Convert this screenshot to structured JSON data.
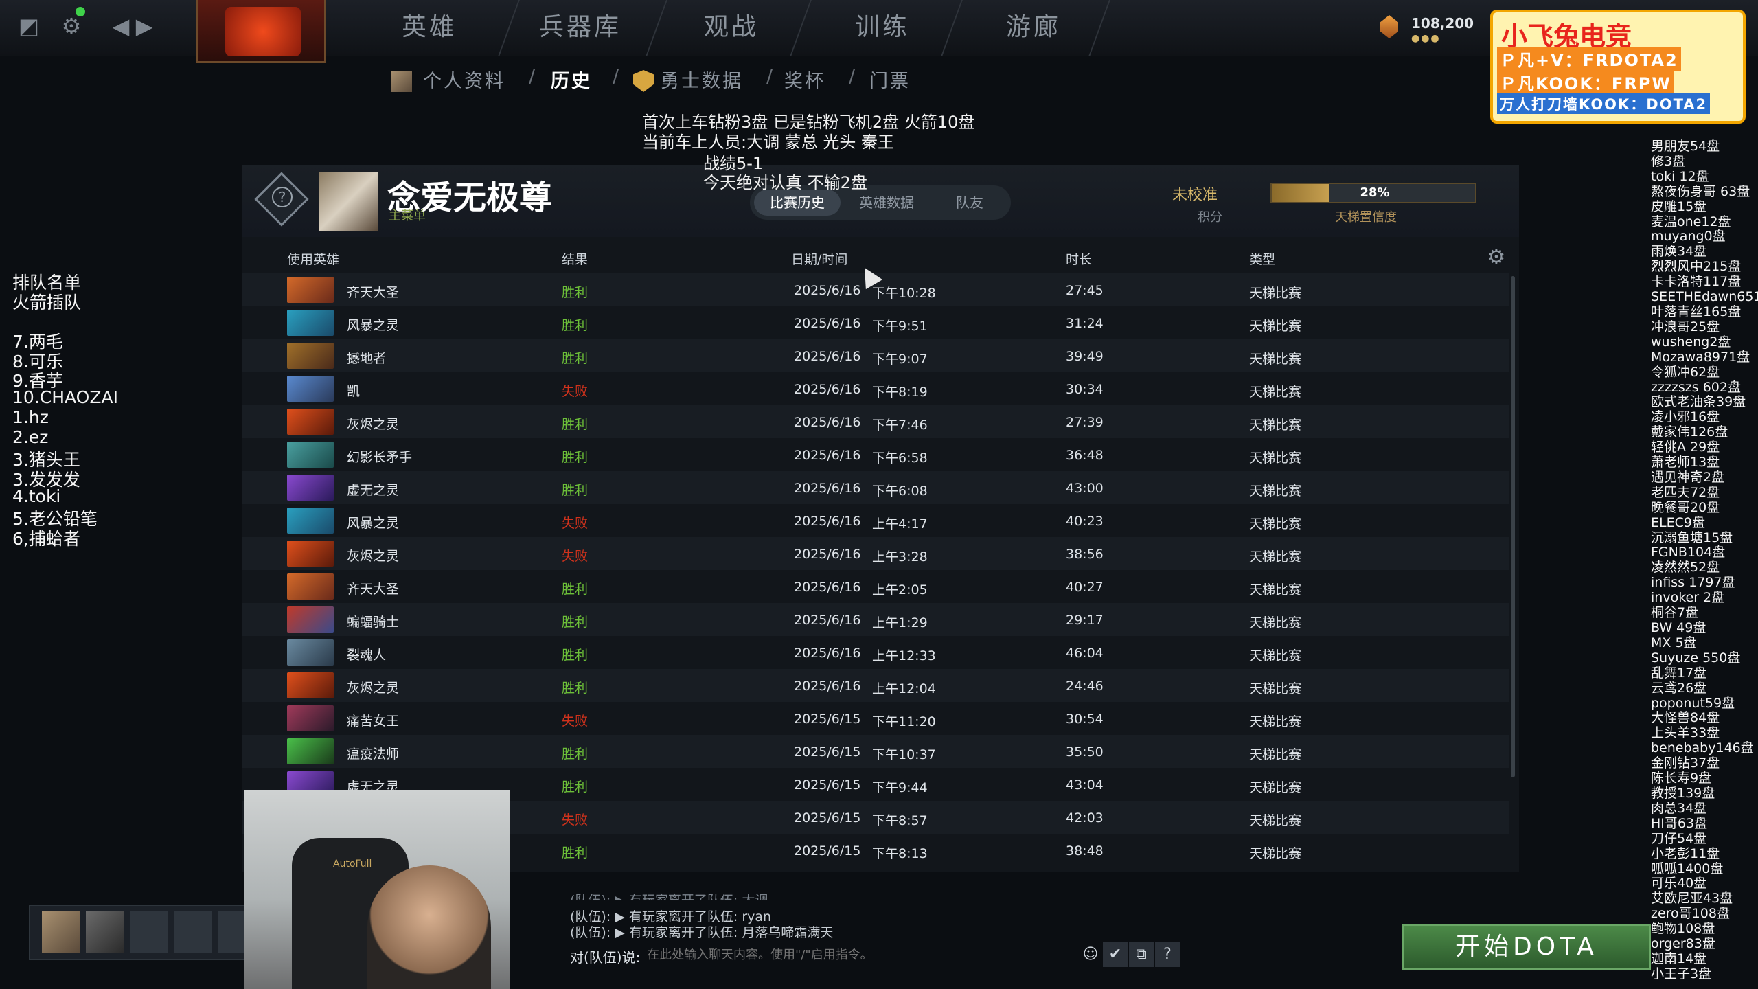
{
  "topbar": {
    "nav": [
      "英雄",
      "兵器库",
      "观战",
      "训练",
      "游廊"
    ],
    "gold": "108,200"
  },
  "subnav": {
    "items": [
      "个人资料",
      "历史",
      "勇士数据",
      "奖杯",
      "门票"
    ],
    "active": "历史",
    "sep": "/"
  },
  "overlay": {
    "line1": "首次上车钻粉3盘 已是钻粉飞机2盘 火箭10盘",
    "line2": "当前车上人员:大调   蒙总 光头  秦王",
    "line3": "战绩5-1",
    "line4": "今天绝对认真 不输2盘"
  },
  "logo": {
    "title": "小飞兔电竞",
    "line1": "Ｐ凡+V：FRDOTA2",
    "line2": "Ｐ凡KOOK：FRPW",
    "line3": "万人打刀墙KOOK：DOTA2"
  },
  "profile": {
    "name": "念爱无极尊",
    "sub": "主菜单",
    "tabs": [
      "比赛历史",
      "英雄数据",
      "队友"
    ],
    "calib": "未校准",
    "calib_sub": "积分",
    "ladder_pct": "28%",
    "ladder_value": 0.28,
    "ladder_label": "天梯置信度"
  },
  "table": {
    "headers": [
      "使用英雄",
      "结果",
      "日期/时间",
      "时长",
      "类型"
    ],
    "rows": [
      {
        "hero": "齐天大圣",
        "result": "胜利",
        "date": "2025/6/16",
        "time": "下午10:28",
        "dur": "27:45",
        "type": "天梯比赛"
      },
      {
        "hero": "风暴之灵",
        "result": "胜利",
        "date": "2025/6/16",
        "time": "下午9:51",
        "dur": "31:24",
        "type": "天梯比赛"
      },
      {
        "hero": "撼地者",
        "result": "胜利",
        "date": "2025/6/16",
        "time": "下午9:07",
        "dur": "39:49",
        "type": "天梯比赛"
      },
      {
        "hero": "凯",
        "result": "失败",
        "date": "2025/6/16",
        "time": "下午8:19",
        "dur": "30:34",
        "type": "天梯比赛"
      },
      {
        "hero": "灰烬之灵",
        "result": "胜利",
        "date": "2025/6/16",
        "time": "下午7:46",
        "dur": "27:39",
        "type": "天梯比赛"
      },
      {
        "hero": "幻影长矛手",
        "result": "胜利",
        "date": "2025/6/16",
        "time": "下午6:58",
        "dur": "36:48",
        "type": "天梯比赛"
      },
      {
        "hero": "虚无之灵",
        "result": "胜利",
        "date": "2025/6/16",
        "time": "下午6:08",
        "dur": "43:00",
        "type": "天梯比赛"
      },
      {
        "hero": "风暴之灵",
        "result": "失败",
        "date": "2025/6/16",
        "time": "上午4:17",
        "dur": "40:23",
        "type": "天梯比赛"
      },
      {
        "hero": "灰烬之灵",
        "result": "失败",
        "date": "2025/6/16",
        "time": "上午3:28",
        "dur": "38:56",
        "type": "天梯比赛"
      },
      {
        "hero": "齐天大圣",
        "result": "胜利",
        "date": "2025/6/16",
        "time": "上午2:05",
        "dur": "40:27",
        "type": "天梯比赛"
      },
      {
        "hero": "蝙蝠骑士",
        "result": "胜利",
        "date": "2025/6/16",
        "time": "上午1:29",
        "dur": "29:17",
        "type": "天梯比赛"
      },
      {
        "hero": "裂魂人",
        "result": "胜利",
        "date": "2025/6/16",
        "time": "上午12:33",
        "dur": "46:04",
        "type": "天梯比赛"
      },
      {
        "hero": "灰烬之灵",
        "result": "胜利",
        "date": "2025/6/16",
        "time": "上午12:04",
        "dur": "24:46",
        "type": "天梯比赛"
      },
      {
        "hero": "痛苦女王",
        "result": "失败",
        "date": "2025/6/15",
        "time": "下午11:20",
        "dur": "30:54",
        "type": "天梯比赛"
      },
      {
        "hero": "瘟疫法师",
        "result": "胜利",
        "date": "2025/6/15",
        "time": "下午10:37",
        "dur": "35:50",
        "type": "天梯比赛"
      },
      {
        "hero": "虚无之灵",
        "result": "胜利",
        "date": "2025/6/15",
        "time": "下午9:44",
        "dur": "43:04",
        "type": "天梯比赛"
      },
      {
        "hero": "",
        "result": "失败",
        "date": "2025/6/15",
        "time": "下午8:57",
        "dur": "42:03",
        "type": "天梯比赛"
      },
      {
        "hero": "",
        "result": "胜利",
        "date": "2025/6/15",
        "time": "下午8:13",
        "dur": "38:48",
        "type": "天梯比赛"
      }
    ]
  },
  "queue": {
    "title1": "排队名单",
    "title2": "火箭插队",
    "items": [
      "7.两毛",
      "8.可乐",
      "9.香芋",
      "10.CHAOZAI",
      "1.hz",
      "2.ez",
      "3.猪头王",
      "3.发发发",
      "4.toki",
      "5.老公铅笔",
      "6,捕蛤者"
    ]
  },
  "right_list": [
    "男朋友54盘",
    "修3盘",
    "toki 12盘",
    "熬夜伤身哥 63盘",
    "皮雕15盘",
    "麦温one12盘",
    "muyang0盘",
    "雨焕34盘",
    "烈烈风中215盘",
    "卡卡洛特117盘",
    "SEETHEdawn651",
    "叶落青丝165盘",
    "冲浪哥25盘",
    "wusheng2盘",
    "Mozawa8971盘",
    "令狐冲62盘",
    "zzzzszs 602盘",
    "欧式老油条39盘",
    "凌小邪16盘",
    "戴家伟126盘",
    "轻佻A 29盘",
    "萧老师13盘",
    "遇见神奇2盘",
    "老匹夫72盘",
    "晚餐哥20盘",
    "ELEC9盘",
    "沉溺鱼塘15盘",
    "FGNB104盘",
    "凌然然52盘",
    "infiss 1797盘",
    "invoker 2盘",
    "桐谷7盘",
    "BW 49盘",
    "MX 5盘",
    "Suyuze 550盘",
    "乱舞17盘",
    "云鸢26盘",
    "poponut59盘",
    "大怪兽84盘",
    "上头羊33盘",
    "benebaby146盘",
    "金刚钻37盘",
    "陈长寿9盘",
    "教授139盘",
    "肉总34盘",
    "HI哥63盘",
    "刀仔54盘",
    "小老彭11盘",
    "呱呱1400盘",
    "可乐40盘",
    "艾欧尼亚43盘",
    "zero哥108盘",
    "鲍物108盘",
    "orger83盘",
    "迦南14盘",
    "小王子3盘"
  ],
  "chat": {
    "line0": "(队伍):  ▶ 有玩家离开了队伍: 大调",
    "line1": "(队伍):  ▶ 有玩家离开了队伍: ryan",
    "line2": "(队伍):  ▶ 有玩家离开了队伍: 月落乌啼霜满天",
    "label": "对(队伍)说:",
    "placeholder": "在此处输入聊天内容。使用\"/\"启用指令。"
  },
  "webcam": {
    "chair_brand": "AutoFull"
  },
  "play_button": "开始DOTA",
  "colors": {
    "win": "#6cbf38",
    "loss": "#d0321c",
    "accent": "#c7a050"
  }
}
